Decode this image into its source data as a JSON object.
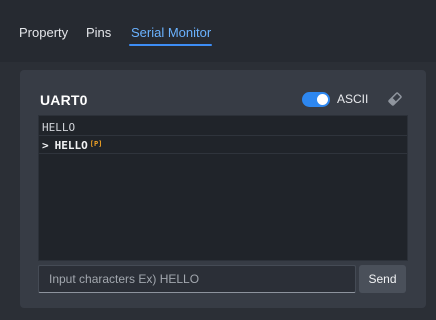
{
  "tabs": [
    {
      "label": "Property",
      "active": false
    },
    {
      "label": "Pins",
      "active": false
    },
    {
      "label": "Serial Monitor",
      "active": true
    }
  ],
  "colors": {
    "accent": "#3d8df6",
    "toggle_on": "#2d87f0",
    "badge": "#f5a524"
  },
  "serial": {
    "title": "UART0",
    "ascii_toggle": {
      "label": "ASCII",
      "on": true
    },
    "clear_icon": "eraser-icon",
    "lines": [
      {
        "text": "HELLO",
        "kind": "received"
      },
      {
        "prompt": ">",
        "text": "HELLO",
        "badge": "[P]",
        "kind": "sent"
      }
    ],
    "input": {
      "placeholder": "Input characters Ex) HELLO",
      "value": ""
    },
    "send_label": "Send"
  }
}
